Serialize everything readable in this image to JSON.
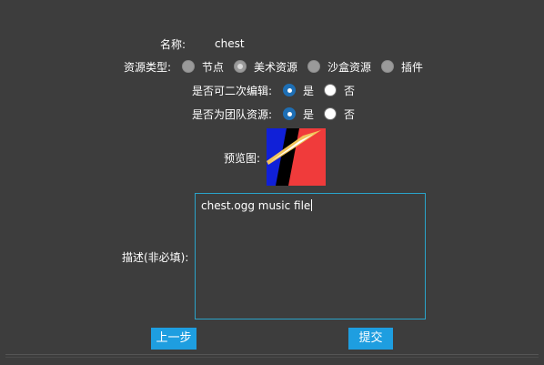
{
  "form": {
    "name_label": "名称:",
    "name_value": "chest",
    "type_label": "资源类型:",
    "type_options": [
      "节点",
      "美术资源",
      "沙盒资源",
      "插件"
    ],
    "type_selected": "美术资源",
    "editable_label": "是否可二次编辑:",
    "team_label": "是否为团队资源:",
    "yes_label": "是",
    "no_label": "否",
    "editable_selected": "是",
    "team_selected": "是",
    "preview_label": "预览图:",
    "description_label": "描述(非必填):",
    "description_value": "chest.ogg music file"
  },
  "buttons": {
    "prev_label": "上一步",
    "submit_label": "提交"
  },
  "colors": {
    "background": "#3d3d3d",
    "accent": "#1e9ee0",
    "radio_checked": "#1e6fb5",
    "textarea_border": "#2aa3c9"
  }
}
